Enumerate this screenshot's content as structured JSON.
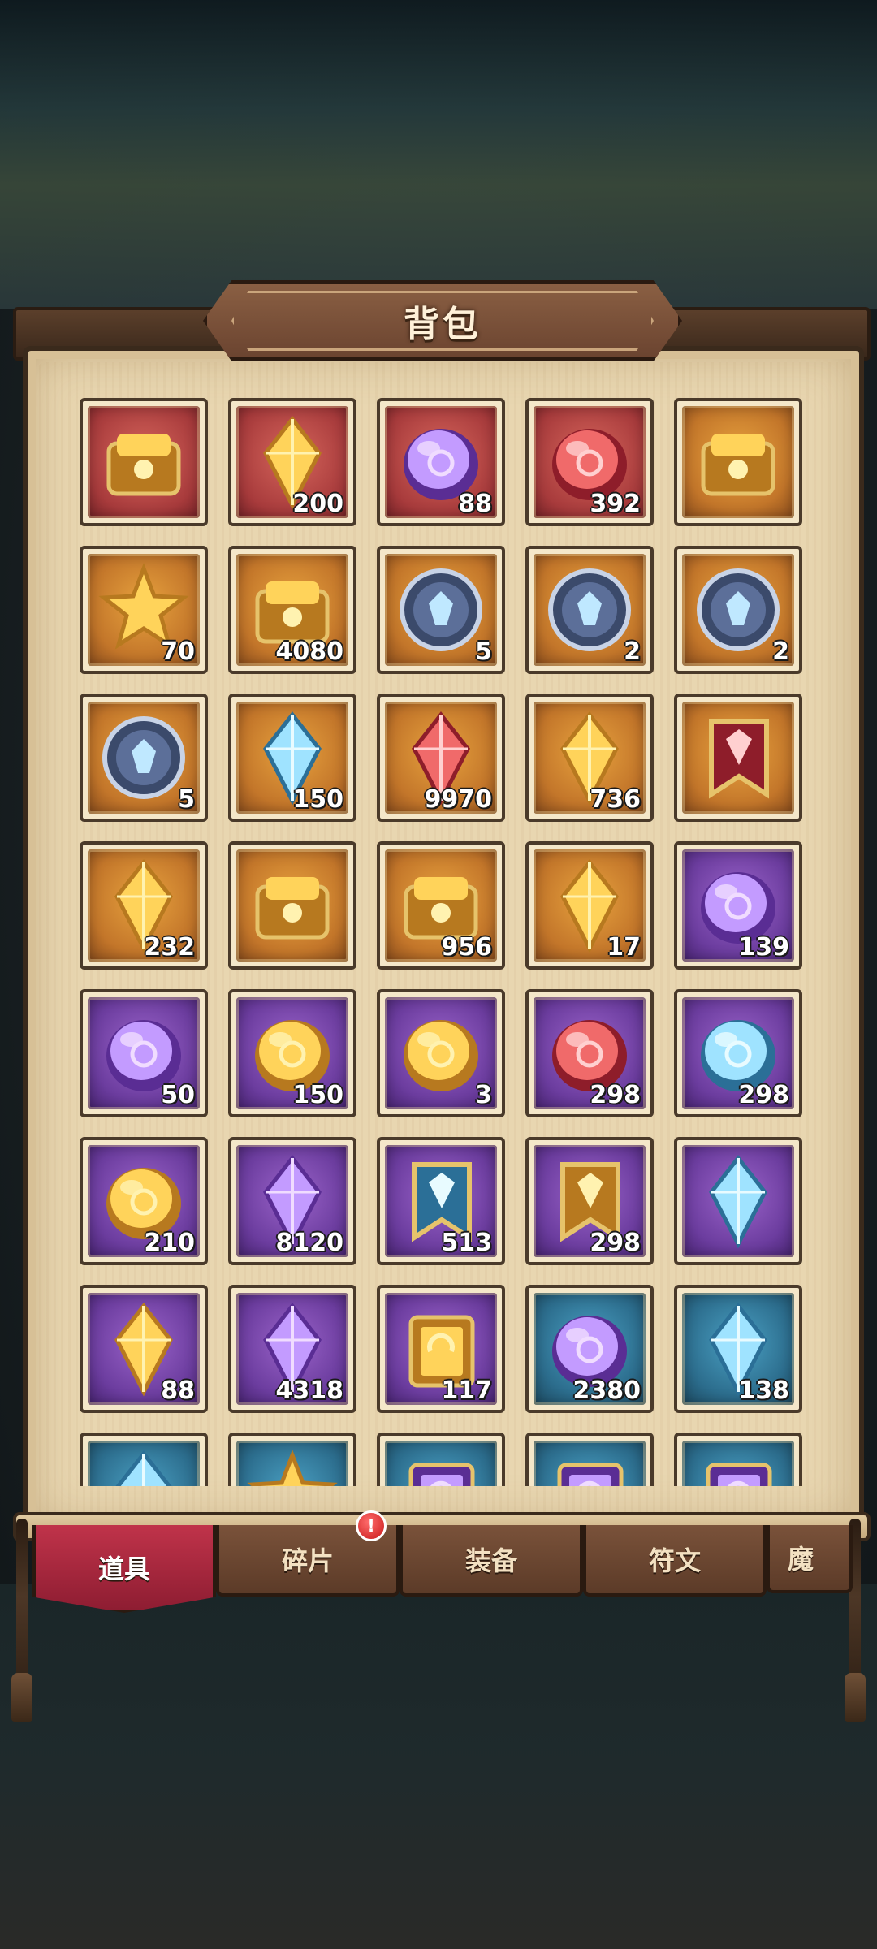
{
  "title": "背包",
  "tabs": [
    {
      "label": "道具",
      "active": true
    },
    {
      "label": "碎片",
      "active": false,
      "badge": "!"
    },
    {
      "label": "装备",
      "active": false
    },
    {
      "label": "符文",
      "active": false
    },
    {
      "label": "魔",
      "active": false
    }
  ],
  "items": [
    {
      "icon": "golden-cannon-icon",
      "rarity": "red",
      "qty": ""
    },
    {
      "icon": "gold-crystal-cluster-icon",
      "rarity": "red",
      "qty": "200"
    },
    {
      "icon": "purple-dragon-gem-icon",
      "rarity": "red",
      "qty": "88"
    },
    {
      "icon": "red-dragon-gem-icon",
      "rarity": "red",
      "qty": "392"
    },
    {
      "icon": "hero-card-chest-icon",
      "rarity": "gold",
      "qty": ""
    },
    {
      "icon": "golden-lion-icon",
      "rarity": "gold",
      "qty": "70"
    },
    {
      "icon": "magic-lamp-icon",
      "rarity": "gold",
      "qty": "4080"
    },
    {
      "icon": "shield-cross-medal-icon",
      "rarity": "gold",
      "qty": "5"
    },
    {
      "icon": "boot-medal-icon",
      "rarity": "gold",
      "qty": "2"
    },
    {
      "icon": "sword-medal-icon",
      "rarity": "gold",
      "qty": "2"
    },
    {
      "icon": "dragon-medal-icon",
      "rarity": "gold",
      "qty": "5"
    },
    {
      "icon": "blue-crystal-crown-icon",
      "rarity": "gold",
      "qty": "150"
    },
    {
      "icon": "pink-crystal-icon",
      "rarity": "gold",
      "qty": "9970"
    },
    {
      "icon": "crystal-golden-box-icon",
      "rarity": "gold",
      "qty": "736"
    },
    {
      "icon": "red-banner-icon",
      "rarity": "gold",
      "qty": ""
    },
    {
      "icon": "gold-shard-icon",
      "rarity": "gold",
      "qty": "232"
    },
    {
      "icon": "treasure-bag-icon",
      "rarity": "gold",
      "qty": ""
    },
    {
      "icon": "golden-scepter-icon",
      "rarity": "gold",
      "qty": "956"
    },
    {
      "icon": "amber-crystal-icon",
      "rarity": "gold",
      "qty": "17"
    },
    {
      "icon": "purple-orb-icon",
      "rarity": "purple",
      "qty": "139"
    },
    {
      "icon": "purple-hex-stone-icon",
      "rarity": "purple",
      "qty": "50"
    },
    {
      "icon": "gold-rune-stone-icon",
      "rarity": "purple",
      "qty": "150"
    },
    {
      "icon": "green-swirl-orb-icon",
      "rarity": "purple",
      "qty": "3"
    },
    {
      "icon": "red-sun-stone-icon",
      "rarity": "purple",
      "qty": "298"
    },
    {
      "icon": "ice-drop-stone-icon",
      "rarity": "purple",
      "qty": "298"
    },
    {
      "icon": "gold-horn-icon",
      "rarity": "purple",
      "qty": "210"
    },
    {
      "icon": "purple-crystal-icon",
      "rarity": "purple",
      "qty": "8120"
    },
    {
      "icon": "blue-banner-icon",
      "rarity": "purple",
      "qty": "513"
    },
    {
      "icon": "silver-banner-icon",
      "rarity": "purple",
      "qty": "298"
    },
    {
      "icon": "blue-diamond-icon",
      "rarity": "purple",
      "qty": ""
    },
    {
      "icon": "target-shards-icon",
      "rarity": "purple",
      "qty": "88"
    },
    {
      "icon": "purple-crystals-icon",
      "rarity": "purple",
      "qty": "4318"
    },
    {
      "icon": "refresh-scroll-icon",
      "rarity": "purple",
      "qty": "117"
    },
    {
      "icon": "purple-swirl-gem-icon",
      "rarity": "blue",
      "qty": "2380"
    },
    {
      "icon": "crystal-pillar-icon",
      "rarity": "blue",
      "qty": "138"
    },
    {
      "icon": "blue-crystal-icon",
      "rarity": "blue",
      "qty": ""
    },
    {
      "icon": "gold-star-icon",
      "rarity": "blue",
      "qty": ""
    },
    {
      "icon": "purple-book-icon",
      "rarity": "blue",
      "qty": ""
    },
    {
      "icon": "purple-tome-icon",
      "rarity": "blue",
      "qty": ""
    },
    {
      "icon": "purple-grimoire-icon",
      "rarity": "blue",
      "qty": ""
    }
  ]
}
